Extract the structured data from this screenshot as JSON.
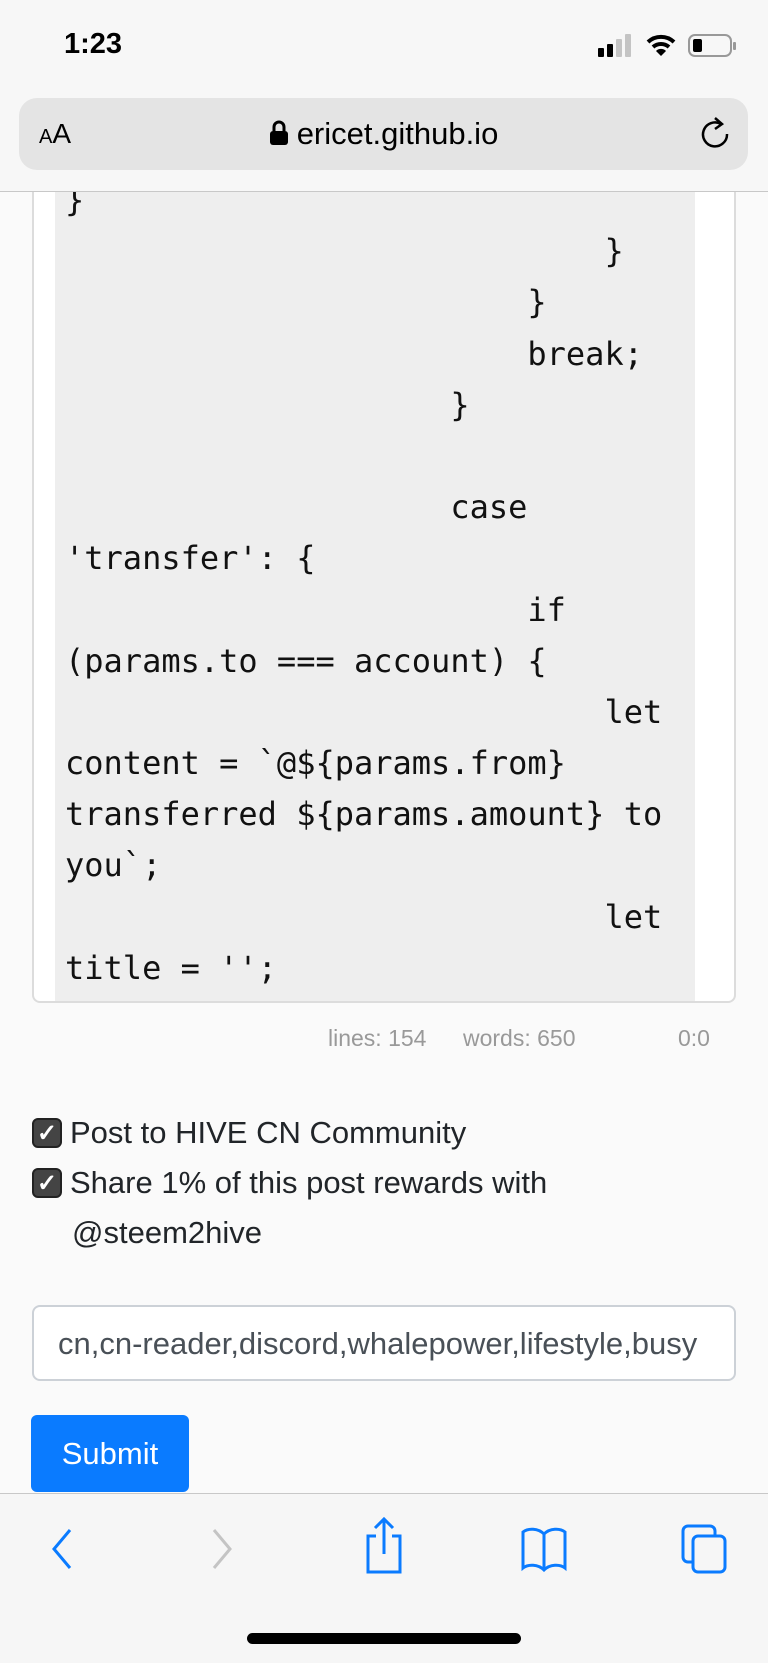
{
  "status_bar": {
    "time": "1:23",
    "signal_bars": 2,
    "battery_level": 0.2
  },
  "browser": {
    "text_size_small": "A",
    "text_size_large": "A",
    "url": "ericet.github.io"
  },
  "editor": {
    "code_lines": [
      "}",
      "                            }",
      "                        }",
      "                        break;",
      "                    }",
      "",
      "                    case",
      "'transfer': {",
      "                        if",
      "(params.to === account) {",
      "                            let",
      "content = `@${params.from}",
      "transferred ${params.amount} to",
      "you`;",
      "                            let",
      "title = '';"
    ],
    "stats": {
      "lines": "lines: 154",
      "words": "words: 650",
      "cursor": "0:0"
    }
  },
  "options": [
    {
      "label": "Post to HIVE CN Community",
      "checked": true
    },
    {
      "label": "Share 1% of this post rewards with",
      "label_cont": "@steem2hive",
      "checked": true
    }
  ],
  "tags_input": {
    "value": "cn,cn-reader,discord,whalepower,lifestyle,busy"
  },
  "submit_label": "Submit",
  "colors": {
    "accent": "#0a7bff"
  },
  "toolbar": {
    "icons": [
      "back-icon",
      "forward-icon",
      "share-icon",
      "bookmarks-icon",
      "tabs-icon"
    ]
  }
}
